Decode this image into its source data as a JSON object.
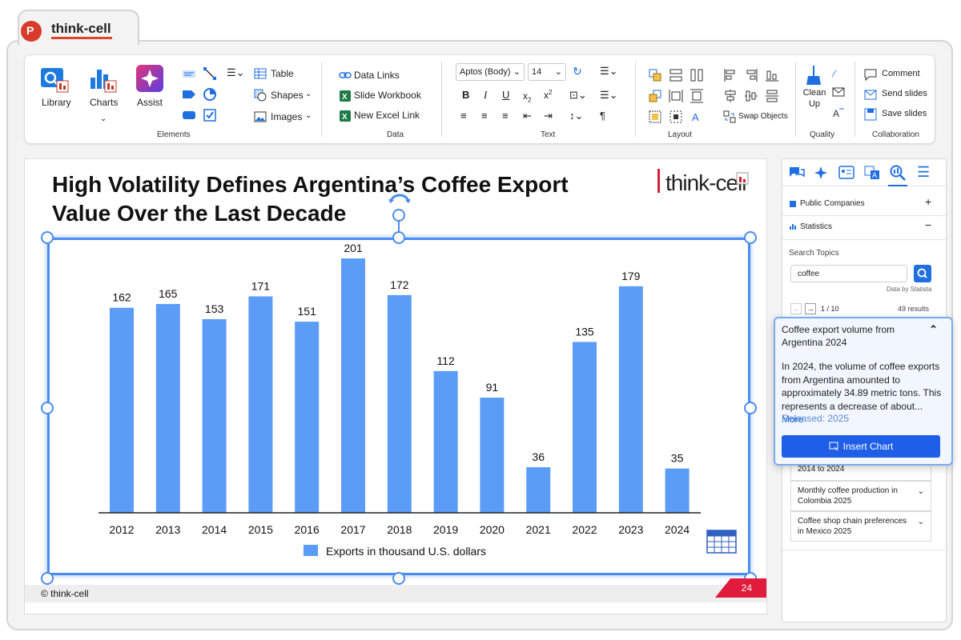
{
  "app": {
    "name": "think-cell"
  },
  "ribbon": {
    "library": "Library",
    "charts": "Charts",
    "assist": "Assist",
    "elements_label": "Elements",
    "table": "Table",
    "shapes": "Shapes",
    "images": "Images",
    "data_links": "Data Links",
    "slide_workbook": "Slide Workbook",
    "new_excel_link": "New Excel Link",
    "data_label": "Data",
    "font_name": "Aptos (Body)",
    "font_size": "14",
    "text_label": "Text",
    "swap_objects": "Swap Objects",
    "layout_label": "Layout",
    "clean_up": "Clean Up",
    "quality_label": "Quality",
    "comment": "Comment",
    "send_slides": "Send slides",
    "save_slides": "Save slides",
    "collaboration_label": "Collaboration"
  },
  "slide": {
    "title": "High Volatility Defines Argentina’s Coffee Export Value Over the Last Decade",
    "logo_text": "think-cell",
    "footer": "© think-cell",
    "page_number": "24"
  },
  "chart_data": {
    "type": "bar",
    "title": "",
    "categories": [
      "2012",
      "2013",
      "2014",
      "2015",
      "2016",
      "2017",
      "2018",
      "2019",
      "2020",
      "2021",
      "2022",
      "2023",
      "2024"
    ],
    "series": [
      {
        "name": "Exports in thousand U.S. dollars",
        "values": [
          162,
          165,
          153,
          171,
          151,
          201,
          172,
          112,
          91,
          36,
          135,
          179,
          35
        ],
        "color": "#5b9cf6"
      }
    ],
    "xlabel": "",
    "ylabel": "",
    "ylim": [
      0,
      201
    ],
    "grid": false,
    "legend": "bottom"
  },
  "panel": {
    "public_companies": "Public Companies",
    "statistics": "Statistics",
    "search_topics": "Search Topics",
    "search_value": "coffee",
    "data_by": "Data by Statista",
    "pager": "1 / 10",
    "results_count": "49 results",
    "results": [
      {
        "label": "2014 to 2024"
      },
      {
        "label": "Monthly coffee production in Colombia 2025"
      },
      {
        "label": "Coffee shop chain preferences in Mexico 2025"
      }
    ]
  },
  "popup": {
    "title": "Coffee export volume from Argentina 2024",
    "body": "In 2024, the volume of coffee exports from Argentina amounted to approximately 34.89 metric tons. This represents a decrease of about...",
    "more": "More",
    "released": "Released: 2025",
    "insert_button": "Insert Chart"
  }
}
